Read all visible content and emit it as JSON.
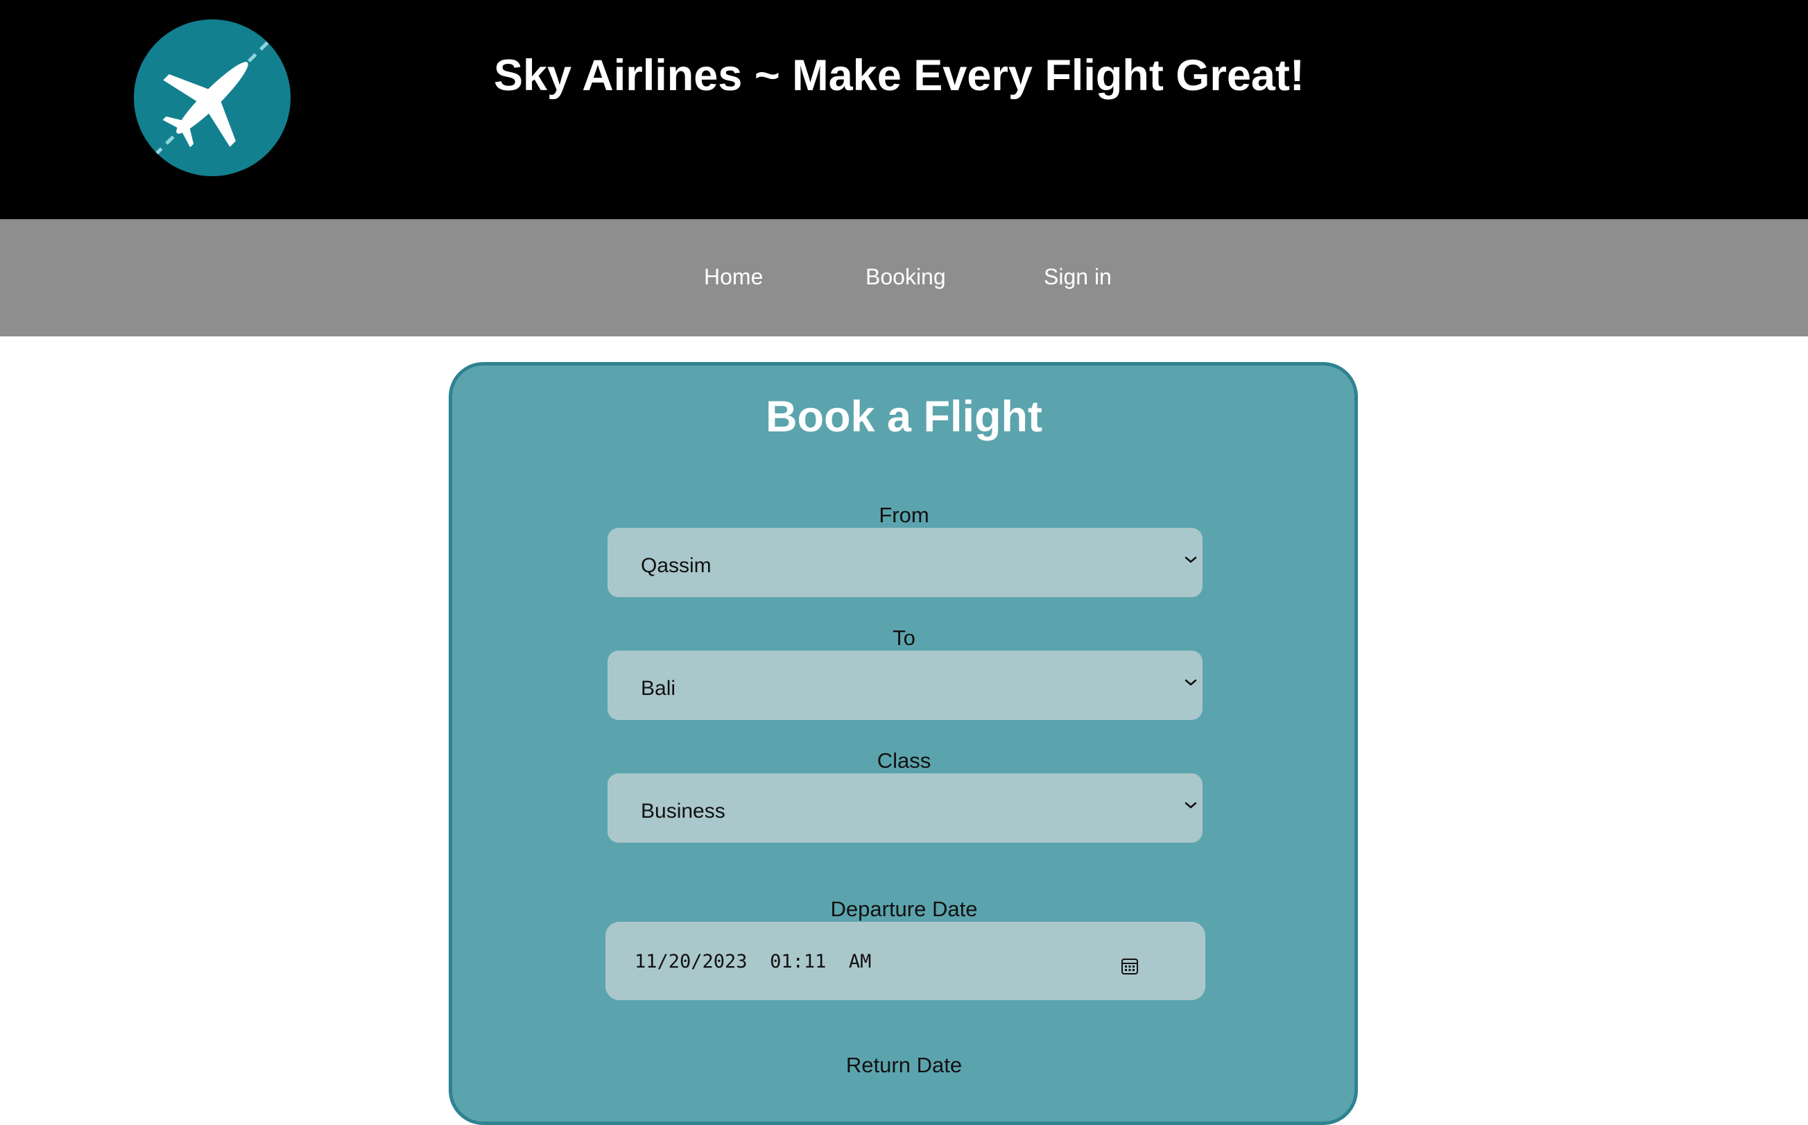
{
  "header": {
    "title": "Sky Airlines ~ Make Every Flight Great!",
    "logo_icon": "airplane-icon",
    "background_color": "#000000",
    "logo_color": "#13808f"
  },
  "nav": {
    "items": [
      {
        "label": "Home"
      },
      {
        "label": "Booking"
      },
      {
        "label": "Sign in"
      }
    ],
    "background_color": "#8e8e8e"
  },
  "booking_form": {
    "title": "Book a Flight",
    "background_color": "#5ca4ad",
    "border_color": "#2e8291",
    "from": {
      "label": "From",
      "value": "Qassim"
    },
    "to": {
      "label": "To",
      "value": "Bali"
    },
    "class": {
      "label": "Class",
      "value": "Business"
    },
    "departure_date": {
      "label": "Departure Date",
      "value": "11/20/2023  01:11  AM",
      "icon": "calendar-icon"
    },
    "return_date": {
      "label": "Return Date"
    }
  }
}
